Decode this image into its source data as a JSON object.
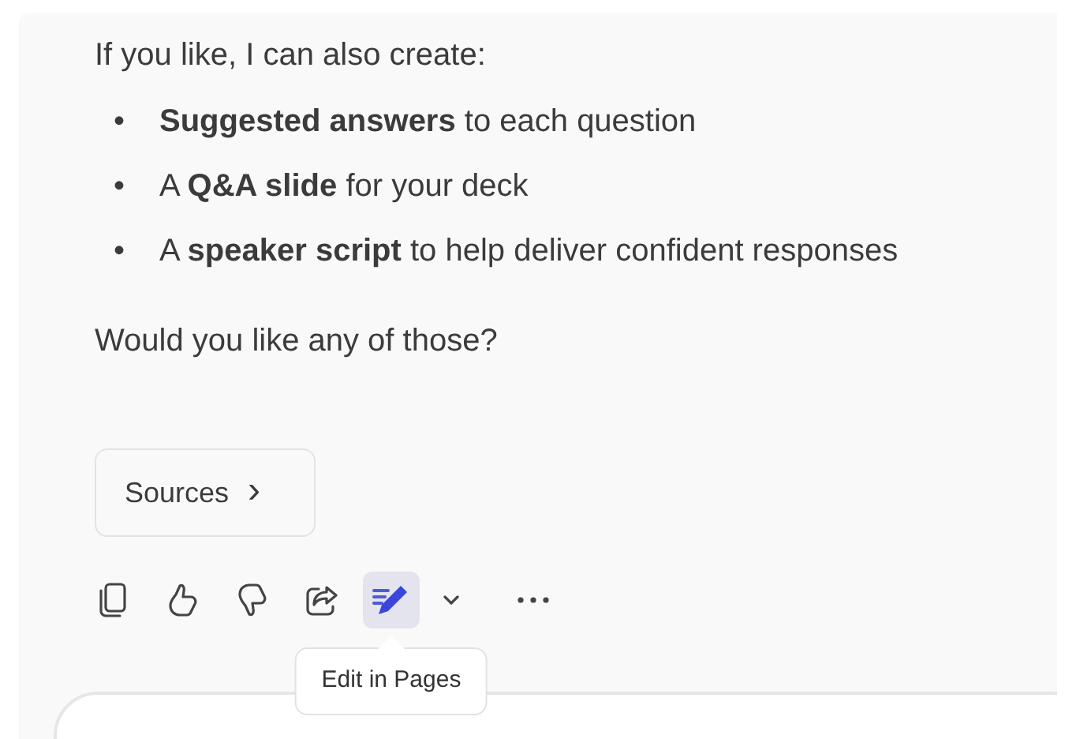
{
  "intro": "If you like, I can also create:",
  "bullets": [
    {
      "marker": "•",
      "text": "**Suggested answers** to each question"
    },
    {
      "marker": "•",
      "text": "A **Q&A slide** for your deck"
    },
    {
      "marker": "•",
      "text": "A **speaker script** to help deliver confident responses"
    }
  ],
  "question": "Would you like any of those?",
  "sources_button": {
    "label": "Sources",
    "chevron": "›"
  },
  "actions": [
    {
      "kind": "copy",
      "selected": false
    },
    {
      "kind": "like",
      "selected": false
    },
    {
      "kind": "dislike",
      "selected": false
    },
    {
      "kind": "share",
      "selected": false
    },
    {
      "kind": "edit",
      "selected": true
    },
    {
      "kind": "dropdown",
      "selected": false
    },
    {
      "kind": "more",
      "selected": false
    }
  ],
  "tooltip": "Edit in Pages"
}
